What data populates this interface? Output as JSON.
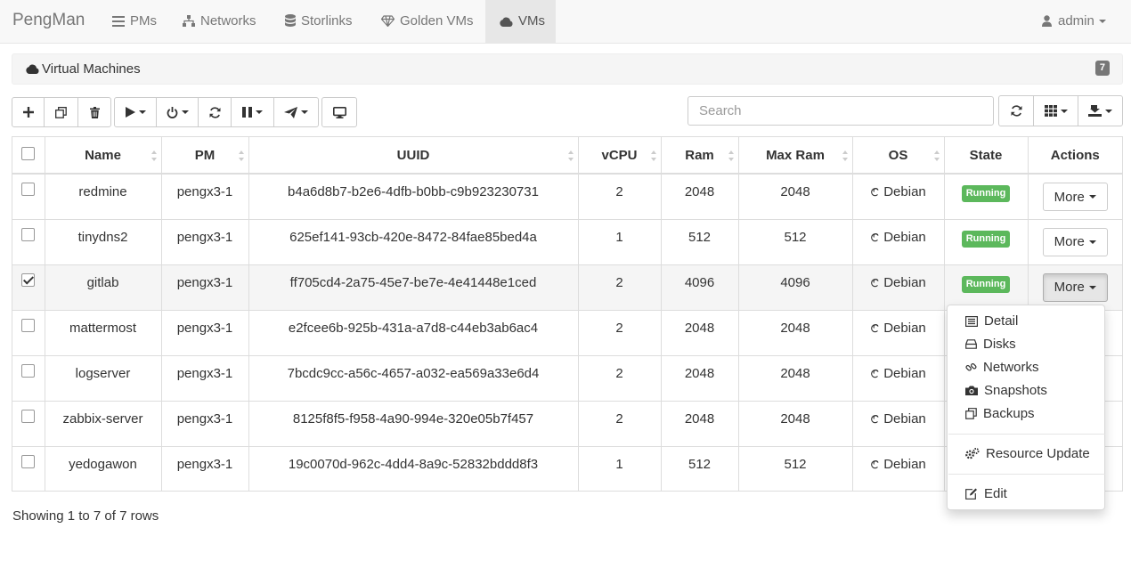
{
  "navbar": {
    "brand": "PengMan",
    "items": [
      {
        "label": "PMs",
        "icon": "list-icon"
      },
      {
        "label": "Networks",
        "icon": "sitemap-icon"
      },
      {
        "label": "Storlinks",
        "icon": "database-icon"
      },
      {
        "label": "Golden VMs",
        "icon": "diamond-icon"
      },
      {
        "label": "VMs",
        "icon": "cloud-icon",
        "active": true
      }
    ],
    "user": {
      "label": "admin",
      "icon": "user-icon"
    }
  },
  "panel": {
    "title": "Virtual Machines",
    "icon": "cloud-icon",
    "count": "7"
  },
  "toolbar": {
    "buttons": [
      {
        "name": "add-button",
        "icon": "plus-icon"
      },
      {
        "name": "clone-button",
        "icon": "copy-icon"
      },
      {
        "name": "delete-button",
        "icon": "trash-icon"
      },
      {
        "name": "start-dropdown-button",
        "icon": "play-icon"
      },
      {
        "name": "power-dropdown-button",
        "icon": "power-icon"
      },
      {
        "name": "refresh-state-button",
        "icon": "refresh-icon"
      },
      {
        "name": "pause-dropdown-button",
        "icon": "pause-icon"
      },
      {
        "name": "migrate-dropdown-button",
        "icon": "send-icon"
      },
      {
        "name": "console-button",
        "icon": "desktop-icon"
      }
    ]
  },
  "search": {
    "placeholder": "Search",
    "value": ""
  },
  "table": {
    "columns": [
      "Name",
      "PM",
      "UUID",
      "vCPU",
      "Ram",
      "Max Ram",
      "OS",
      "State",
      "Actions"
    ],
    "rows": [
      {
        "name": "redmine",
        "pm": "pengx3-1",
        "uuid": "b4a6d8b7-b2e6-4dfb-b0bb-c9b923230731",
        "vcpu": "2",
        "ram": "2048",
        "max_ram": "2048",
        "os": "Debian",
        "state": "Running",
        "action": "More",
        "checked": false
      },
      {
        "name": "tinydns2",
        "pm": "pengx3-1",
        "uuid": "625ef141-93cb-420e-8472-84fae85bed4a",
        "vcpu": "1",
        "ram": "512",
        "max_ram": "512",
        "os": "Debian",
        "state": "Running",
        "action": "More",
        "checked": false
      },
      {
        "name": "gitlab",
        "pm": "pengx3-1",
        "uuid": "ff705cd4-2a75-45e7-be7e-4e41448e1ced",
        "vcpu": "2",
        "ram": "4096",
        "max_ram": "4096",
        "os": "Debian",
        "state": "Running",
        "action": "More",
        "checked": true
      },
      {
        "name": "mattermost",
        "pm": "pengx3-1",
        "uuid": "e2fcee6b-925b-431a-a7d8-c44eb3ab6ac4",
        "vcpu": "2",
        "ram": "2048",
        "max_ram": "2048",
        "os": "Debian",
        "state": "",
        "action": "",
        "checked": false
      },
      {
        "name": "logserver",
        "pm": "pengx3-1",
        "uuid": "7bcdc9cc-a56c-4657-a032-ea569a33e6d4",
        "vcpu": "2",
        "ram": "2048",
        "max_ram": "2048",
        "os": "Debian",
        "state": "",
        "action": "",
        "checked": false
      },
      {
        "name": "zabbix-server",
        "pm": "pengx3-1",
        "uuid": "8125f8f5-f958-4a90-994e-320e05b7f457",
        "vcpu": "2",
        "ram": "2048",
        "max_ram": "2048",
        "os": "Debian",
        "state": "",
        "action": "",
        "checked": false
      },
      {
        "name": "yedogawon",
        "pm": "pengx3-1",
        "uuid": "19c0070d-962c-4dd4-8a9c-52832bddd8f3",
        "vcpu": "1",
        "ram": "512",
        "max_ram": "512",
        "os": "Debian",
        "state": "",
        "action": "",
        "checked": false
      }
    ]
  },
  "pagination": {
    "summary": "Showing 1 to 7 of 7 rows"
  },
  "more_menu": {
    "items": [
      {
        "label": "Detail",
        "icon": "list-alt-icon"
      },
      {
        "label": "Disks",
        "icon": "hdd-icon"
      },
      {
        "label": "Networks",
        "icon": "link-icon"
      },
      {
        "label": "Snapshots",
        "icon": "camera-icon"
      },
      {
        "label": "Backups",
        "icon": "copy-icon"
      },
      {
        "label": "Resource Update",
        "icon": "cogs-icon"
      },
      {
        "label": "Edit",
        "icon": "edit-icon"
      }
    ]
  },
  "colors": {
    "running": "#5cb85c",
    "navbar_bg": "#f8f8f8",
    "badge": "#777777"
  }
}
